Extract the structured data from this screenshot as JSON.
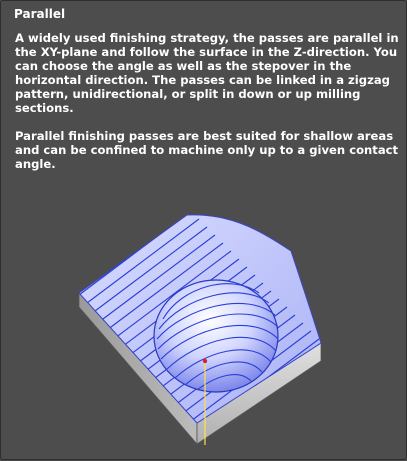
{
  "tooltip": {
    "title": "Parallel",
    "paragraph1": "A widely used finishing strategy, the passes are parallel in the XY-plane and follow the surface in the Z-direction. You can choose the angle as well as the stepover in the horizontal direction. The passes can be linked in a zigzag pattern, unidirectional, or split in down or up milling sections.",
    "paragraph2": "Parallel finishing passes are best suited for shallow areas and can be confined to machine only up to a given contact angle."
  },
  "illustration": {
    "icon": "parallel-finishing-toolpath-illustration",
    "toolpath_color": "#2a3fd6",
    "surface_color": "#b9c0ff",
    "block_color": "#c9c9c9"
  }
}
